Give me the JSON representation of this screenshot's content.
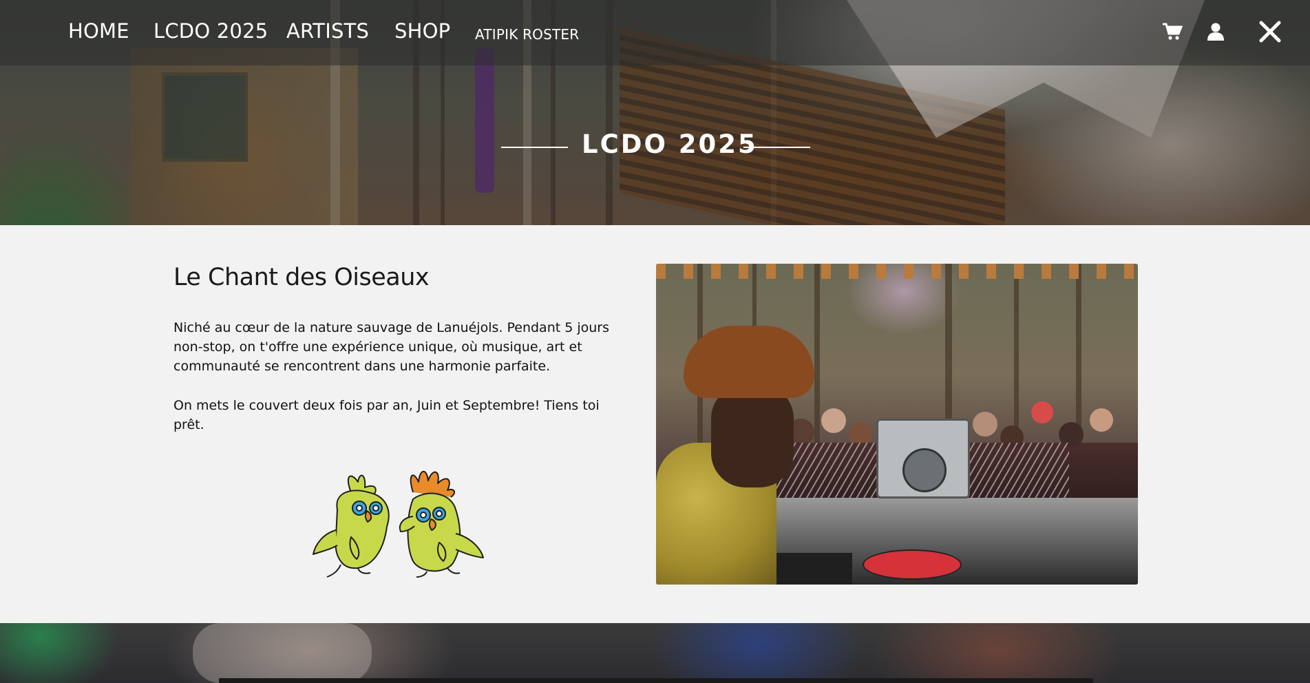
{
  "nav": {
    "items": [
      {
        "label": "HOME"
      },
      {
        "label": "LCDO 2025"
      },
      {
        "label": "ARTISTS"
      },
      {
        "label": "SHOP"
      },
      {
        "label": "ATIPIK ROSTER"
      }
    ],
    "icons": {
      "cart": "cart-icon",
      "account": "user-icon",
      "close": "close-icon"
    }
  },
  "hero": {
    "title": "LCDO 2025"
  },
  "intro": {
    "title": "Le Chant des Oiseaux",
    "paragraph1": "Niché au cœur de la nature sauvage de Lanuéjols. Pendant 5 jours non-stop, on t'offre une expérience unique, où musique, art et communauté se rencontrent dans une harmonie parfaite.",
    "paragraph2": "On mets le couvert deux fois par an, Juin et Septembre! Tiens toi prêt."
  },
  "colors": {
    "text_light": "#ffffff",
    "text_dark": "#111111",
    "page_bg": "#f2f2f2",
    "bird_green": "#c7d94a",
    "bird_orange": "#e98a2b",
    "bird_eye_blue": "#3aa7e0"
  }
}
